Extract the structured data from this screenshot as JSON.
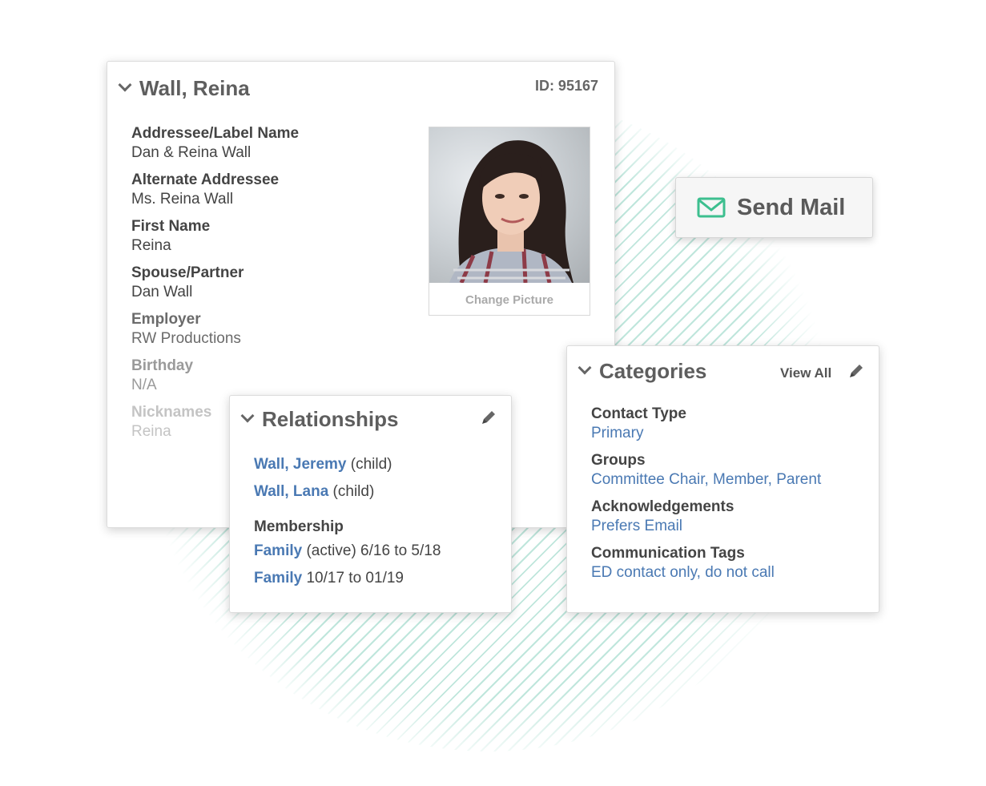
{
  "contact": {
    "name": "Wall, Reina",
    "id_label": "ID: 95167",
    "fields": [
      {
        "label": "Addressee/Label Name",
        "value": "Dan & Reina Wall"
      },
      {
        "label": "Alternate Addressee",
        "value": "Ms. Reina Wall"
      },
      {
        "label": "First Name",
        "value": "Reina"
      },
      {
        "label": "Spouse/Partner",
        "value": "Dan Wall"
      },
      {
        "label": "Employer",
        "value": "RW Productions"
      },
      {
        "label": "Birthday",
        "value": "N/A"
      },
      {
        "label": "Nicknames",
        "value": "Reina"
      }
    ],
    "change_picture_label": "Change Picture"
  },
  "send_mail": {
    "label": "Send Mail",
    "icon": "envelope-icon",
    "icon_color": "#3dbf8f"
  },
  "relationships": {
    "title": "Relationships",
    "people": [
      {
        "name": "Wall, Jeremy",
        "relation": "(child)"
      },
      {
        "name": "Wall, Lana",
        "relation": "(child)"
      }
    ],
    "membership_label": "Membership",
    "memberships": [
      {
        "name": "Family",
        "detail": "(active) 6/16 to 5/18"
      },
      {
        "name": "Family",
        "detail": "10/17 to 01/19"
      }
    ]
  },
  "categories": {
    "title": "Categories",
    "view_all": "View All",
    "items": [
      {
        "label": "Contact Type",
        "value": "Primary"
      },
      {
        "label": "Groups",
        "value": "Committee Chair, Member, Parent"
      },
      {
        "label": "Acknowledgements",
        "value": "Prefers Email"
      },
      {
        "label": "Communication Tags",
        "value": "ED contact only, do not call"
      }
    ]
  },
  "colors": {
    "link": "#4a79b3",
    "accent_green": "#3dbf8f",
    "stripe": "#bfe6dc"
  }
}
